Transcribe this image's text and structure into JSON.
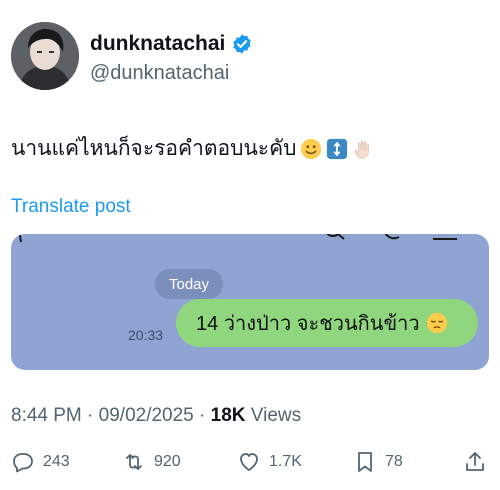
{
  "user": {
    "display_name": "dunknatachai",
    "handle": "@dunknatachai"
  },
  "tweet": {
    "text": "นานแค่ไหนก็จะรอคำตอบนะคับ",
    "translate_label": "Translate post",
    "time": "8:44 PM",
    "date": "09/02/2025",
    "views_count": "18K",
    "views_label": "Views"
  },
  "media": {
    "day_label": "Today",
    "message_time": "20:33",
    "message_text": "14 ว่างป่าว จะชวนกินข้าว"
  },
  "actions": {
    "replies": "243",
    "reposts": "920",
    "likes": "1.7K",
    "bookmarks": "78"
  },
  "colors": {
    "link": "#1d9bf0",
    "verified": "#1d9bf0",
    "chat_background": "#8fa4d2",
    "bubble": "#8fd67e"
  }
}
